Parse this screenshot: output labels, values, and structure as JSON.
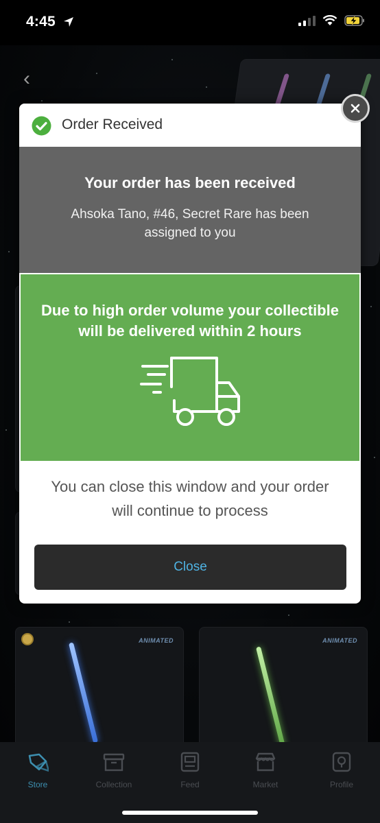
{
  "status": {
    "time": "4:45"
  },
  "modal": {
    "title": "Order Received",
    "heading": "Your order has been received",
    "assigned_text": "Ahsoka Tano, #46, Secret Rare has been assigned to you",
    "delivery_text": "Due to high order volume your collectible will be delivered within 2 hours",
    "note_text": "You can close this window and your order will continue to process",
    "close_label": "Close",
    "colors": {
      "grey": "#646464",
      "green": "#64ad52",
      "link": "#4fb3e3"
    }
  },
  "background": {
    "cards": [
      {
        "badge": "ANIMATED"
      },
      {
        "badge": "ANIMATED"
      }
    ]
  },
  "tabs": [
    {
      "label": "Store",
      "icon": "tag-icon",
      "active": true
    },
    {
      "label": "Collection",
      "icon": "archive-box-icon",
      "active": false
    },
    {
      "label": "Feed",
      "icon": "feed-icon",
      "active": false
    },
    {
      "label": "Market",
      "icon": "storefront-icon",
      "active": false
    },
    {
      "label": "Profile",
      "icon": "profile-icon",
      "active": false
    }
  ]
}
